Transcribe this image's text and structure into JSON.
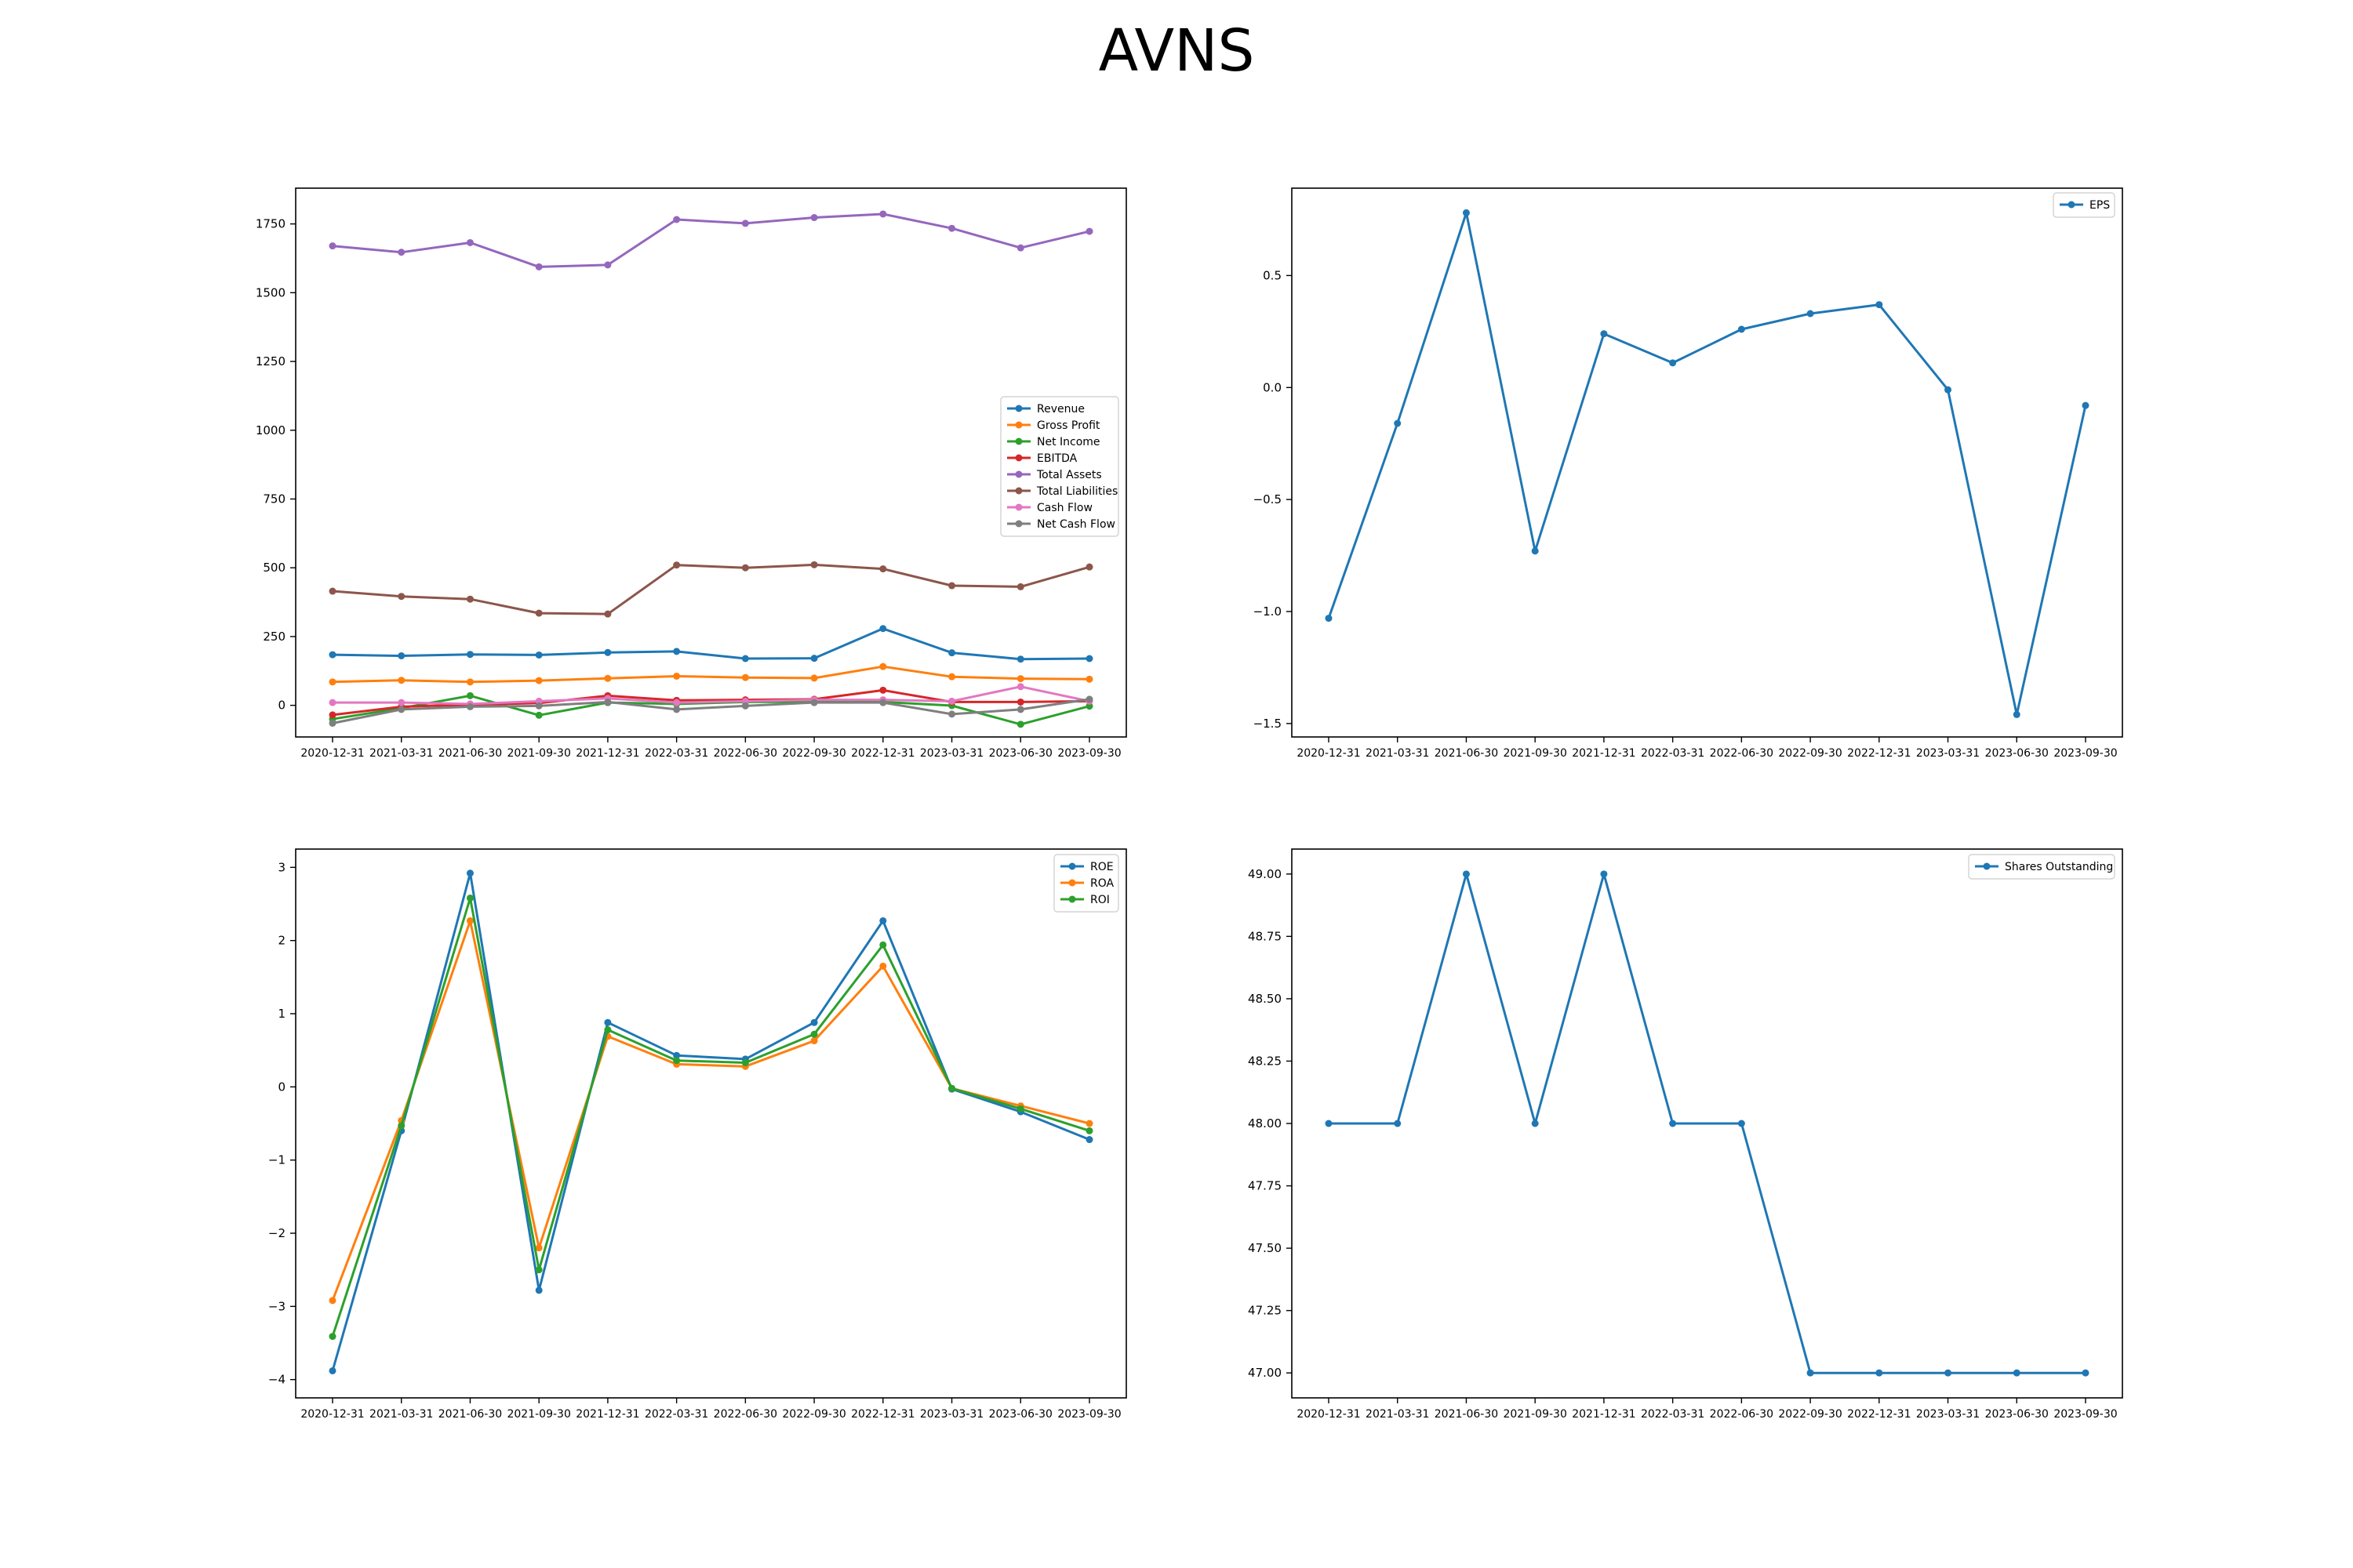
{
  "suptitle": "AVNS",
  "chart_data": [
    {
      "type": "line",
      "title": "",
      "xlabel": "",
      "ylabel": "",
      "categories": [
        "2020-12-31",
        "2021-03-31",
        "2021-06-30",
        "2021-09-30",
        "2021-12-31",
        "2022-03-31",
        "2022-06-30",
        "2022-09-30",
        "2022-12-31",
        "2023-03-31",
        "2023-06-30",
        "2023-09-30"
      ],
      "ylim": [
        -115,
        1880
      ],
      "yticks": [
        0,
        250,
        500,
        750,
        1000,
        1250,
        1500,
        1750
      ],
      "ytick_labels": [
        "0",
        "250",
        "500",
        "750",
        "1000",
        "1250",
        "1500",
        "1750"
      ],
      "grid": false,
      "legend_position": "center-right",
      "series": [
        {
          "name": "Revenue",
          "color": "#1f77b4",
          "values": [
            184,
            180,
            185,
            183,
            192,
            196,
            170,
            171,
            279,
            191,
            168,
            170
          ]
        },
        {
          "name": "Gross Profit",
          "color": "#ff7f0e",
          "values": [
            85,
            91,
            85,
            90,
            98,
            106,
            101,
            99,
            141,
            104,
            97,
            95
          ]
        },
        {
          "name": "Net Income",
          "color": "#2ca02c",
          "values": [
            -50,
            -10,
            35,
            -36,
            10,
            5,
            12,
            13,
            12,
            -1,
            -69,
            -3
          ]
        },
        {
          "name": "EBITDA",
          "color": "#d62728",
          "values": [
            -35,
            -5,
            2,
            8,
            35,
            18,
            20,
            22,
            55,
            12,
            12,
            15
          ]
        },
        {
          "name": "Total Assets",
          "color": "#9467bd",
          "values": [
            1670,
            1647,
            1682,
            1594,
            1601,
            1766,
            1752,
            1773,
            1786,
            1734,
            1663,
            1723
          ]
        },
        {
          "name": "Total Liabilities",
          "color": "#8c564b",
          "values": [
            415,
            396,
            386,
            335,
            332,
            510,
            500,
            511,
            496,
            435,
            431,
            503
          ]
        },
        {
          "name": "Cash Flow",
          "color": "#e377c2",
          "values": [
            10,
            10,
            5,
            15,
            25,
            10,
            15,
            20,
            20,
            15,
            68,
            15
          ]
        },
        {
          "name": "Net Cash Flow",
          "color": "#7f7f7f",
          "values": [
            -65,
            -15,
            -5,
            -2,
            12,
            -15,
            -2,
            10,
            10,
            -32,
            -15,
            22
          ]
        }
      ]
    },
    {
      "type": "line",
      "title": "",
      "xlabel": "",
      "ylabel": "",
      "categories": [
        "2020-12-31",
        "2021-03-31",
        "2021-06-30",
        "2021-09-30",
        "2021-12-31",
        "2022-03-31",
        "2022-06-30",
        "2022-09-30",
        "2022-12-31",
        "2023-03-31",
        "2023-06-30",
        "2023-09-30"
      ],
      "ylim": [
        -1.56,
        0.89
      ],
      "yticks": [
        -1.5,
        -1.0,
        -0.5,
        0.0,
        0.5
      ],
      "ytick_labels": [
        "−1.5",
        "−1.0",
        "−0.5",
        "0.0",
        "0.5"
      ],
      "grid": false,
      "legend_position": "top-right",
      "series": [
        {
          "name": "EPS",
          "color": "#1f77b4",
          "values": [
            -1.03,
            -0.16,
            0.78,
            -0.73,
            0.24,
            0.11,
            0.26,
            0.33,
            0.37,
            -0.01,
            -1.46,
            -0.08
          ]
        }
      ]
    },
    {
      "type": "line",
      "title": "",
      "xlabel": "",
      "ylabel": "",
      "categories": [
        "2020-12-31",
        "2021-03-31",
        "2021-06-30",
        "2021-09-30",
        "2021-12-31",
        "2022-03-31",
        "2022-06-30",
        "2022-09-30",
        "2022-12-31",
        "2023-03-31",
        "2023-06-30",
        "2023-09-30"
      ],
      "ylim": [
        -4.25,
        3.25
      ],
      "yticks": [
        -4,
        -3,
        -2,
        -1,
        0,
        1,
        2,
        3
      ],
      "ytick_labels": [
        "−4",
        "−3",
        "−2",
        "−1",
        "0",
        "1",
        "2",
        "3"
      ],
      "grid": false,
      "legend_position": "top-right",
      "series": [
        {
          "name": "ROE",
          "color": "#1f77b4",
          "values": [
            -3.88,
            -0.6,
            2.92,
            -2.78,
            0.88,
            0.43,
            0.38,
            0.88,
            2.27,
            -0.03,
            -0.34,
            -0.72
          ]
        },
        {
          "name": "ROA",
          "color": "#ff7f0e",
          "values": [
            -2.92,
            -0.46,
            2.27,
            -2.2,
            0.69,
            0.31,
            0.28,
            0.63,
            1.65,
            -0.02,
            -0.26,
            -0.5
          ]
        },
        {
          "name": "ROI",
          "color": "#2ca02c",
          "values": [
            -3.41,
            -0.53,
            2.58,
            -2.5,
            0.78,
            0.36,
            0.33,
            0.72,
            1.94,
            -0.02,
            -0.3,
            -0.6
          ]
        }
      ]
    },
    {
      "type": "line",
      "title": "",
      "xlabel": "",
      "ylabel": "",
      "categories": [
        "2020-12-31",
        "2021-03-31",
        "2021-06-30",
        "2021-09-30",
        "2021-12-31",
        "2022-03-31",
        "2022-06-30",
        "2022-09-30",
        "2022-12-31",
        "2023-03-31",
        "2023-06-30",
        "2023-09-30"
      ],
      "ylim": [
        46.9,
        49.1
      ],
      "yticks": [
        47.0,
        47.25,
        47.5,
        47.75,
        48.0,
        48.25,
        48.5,
        48.75,
        49.0
      ],
      "ytick_labels": [
        "47.00",
        "47.25",
        "47.50",
        "47.75",
        "48.00",
        "48.25",
        "48.50",
        "48.75",
        "49.00"
      ],
      "grid": false,
      "legend_position": "top-right",
      "series": [
        {
          "name": "Shares Outstanding",
          "color": "#1f77b4",
          "values": [
            48,
            48,
            49,
            48,
            49,
            48,
            48,
            47,
            47,
            47,
            47,
            47
          ]
        }
      ]
    }
  ]
}
